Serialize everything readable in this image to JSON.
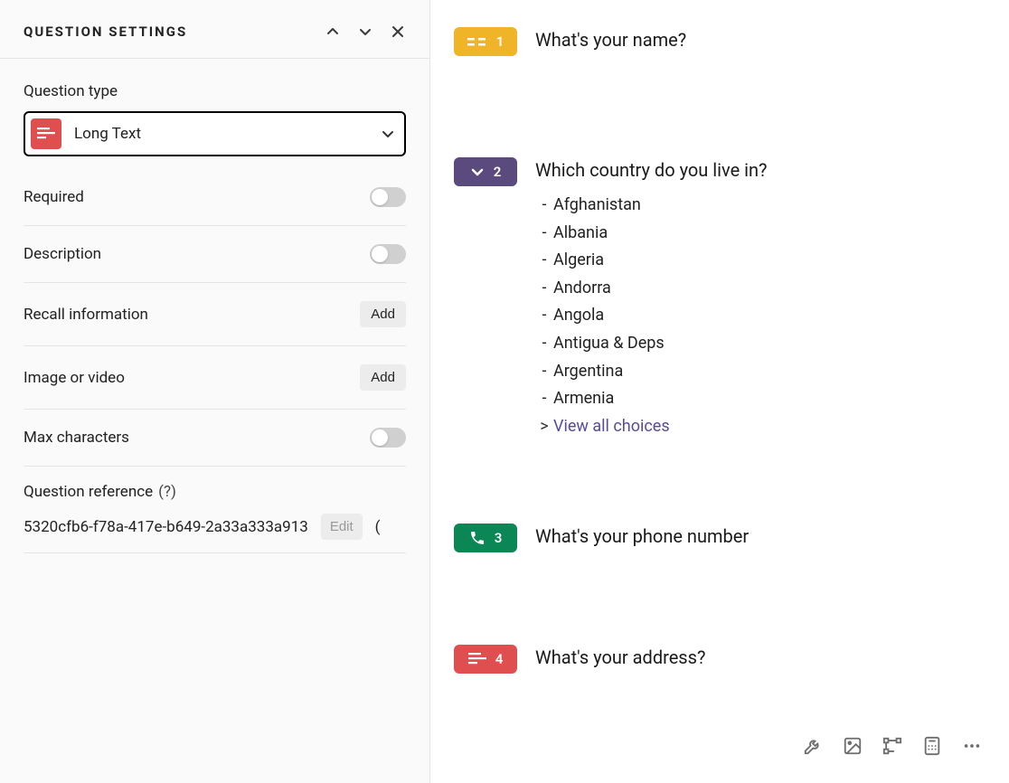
{
  "sidebar": {
    "title": "Question Settings",
    "question_type": {
      "label": "Question type",
      "value": "Long Text"
    },
    "required": {
      "label": "Required",
      "on": false
    },
    "description": {
      "label": "Description",
      "on": false
    },
    "recall": {
      "label": "Recall information",
      "action": "Add"
    },
    "media": {
      "label": "Image or video",
      "action": "Add"
    },
    "max_chars": {
      "label": "Max characters",
      "on": false
    },
    "reference": {
      "label": "Question reference",
      "help": "(?)",
      "value": "5320cfb6-f78a-417e-b649-2a33a333a913",
      "edit": "Edit",
      "paren": "("
    }
  },
  "questions": [
    {
      "number": "1",
      "badge_color": "yellow",
      "icon": "short-text-icon",
      "text": "What's your name?"
    },
    {
      "number": "2",
      "badge_color": "purple",
      "icon": "dropdown-icon",
      "text": "Which country do you live in?",
      "choices": [
        "Afghanistan",
        "Albania",
        "Algeria",
        "Andorra",
        "Angola",
        "Antigua & Deps",
        "Argentina",
        "Armenia"
      ],
      "view_all": "View all choices"
    },
    {
      "number": "3",
      "badge_color": "green",
      "icon": "phone-icon",
      "text": "What's your phone number"
    },
    {
      "number": "4",
      "badge_color": "red",
      "icon": "long-text-icon",
      "text": "What's your address?"
    }
  ],
  "toolbar": {
    "wrench": "wrench-icon",
    "image": "image-icon",
    "branch": "branch-icon",
    "calc": "calculator-icon",
    "more": "more-icon"
  }
}
